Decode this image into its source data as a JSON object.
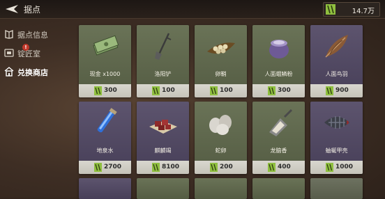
{
  "header": {
    "title": "据点",
    "currency_value": "14.7万"
  },
  "sidebar": {
    "items": [
      {
        "label": "据点信息",
        "icon": "book-icon",
        "active": false
      },
      {
        "label": "锭匠室",
        "icon": "anvil-icon",
        "active": false,
        "badge": "!"
      },
      {
        "label": "兑换商店",
        "icon": "shop-icon",
        "active": true
      }
    ]
  },
  "shop": {
    "items": [
      {
        "name": "现金 x1000",
        "price": "300",
        "icon": "cash-icon",
        "rarity": "green"
      },
      {
        "name": "洛阳铲",
        "price": "100",
        "icon": "shovel-icon",
        "rarity": "green"
      },
      {
        "name": "卵鞘",
        "price": "100",
        "icon": "eggs-leaf-icon",
        "rarity": "green"
      },
      {
        "name": "人面蛾鳞粉",
        "price": "300",
        "icon": "powder-jar-icon",
        "rarity": "green"
      },
      {
        "name": "人面鸟羽",
        "price": "900",
        "icon": "feather-icon",
        "rarity": "purple"
      },
      {
        "name": "地泉水",
        "price": "2700",
        "icon": "vial-icon",
        "rarity": "purple"
      },
      {
        "name": "麒麟竭",
        "price": "8100",
        "icon": "resin-tray-icon",
        "rarity": "purple"
      },
      {
        "name": "蛇卵",
        "price": "200",
        "icon": "snake-eggs-icon",
        "rarity": "green"
      },
      {
        "name": "龙脑香",
        "price": "400",
        "icon": "scoop-icon",
        "rarity": "green"
      },
      {
        "name": "蚰蜒甲壳",
        "price": "1000",
        "icon": "shell-icon",
        "rarity": "purple"
      }
    ]
  },
  "colors": {
    "green_card": "#5f674c",
    "purple_card": "#524a64",
    "price_bar": "#d2d0c7",
    "currency_icon": "#8fbf3f"
  }
}
